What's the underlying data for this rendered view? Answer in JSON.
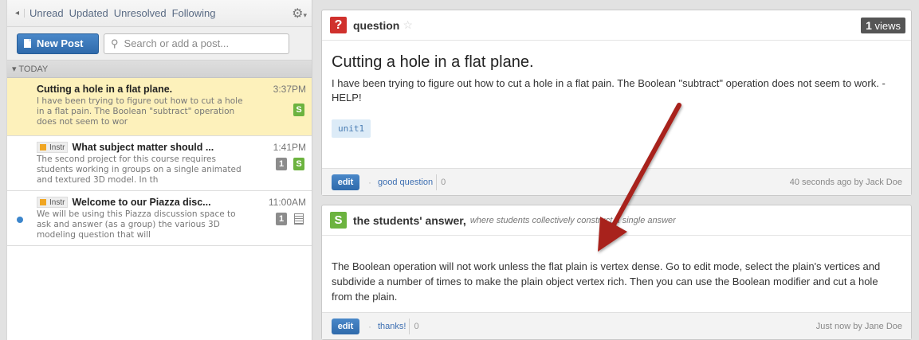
{
  "feed": {
    "collapse_glyph": "◂",
    "filters": [
      "Unread",
      "Updated",
      "Unresolved",
      "Following"
    ],
    "settings_icon": "gear-icon",
    "new_post_label": "New Post",
    "search_placeholder": "Search or add a post...",
    "group_label": "▾ TODAY",
    "posts": [
      {
        "title": "Cutting a hole in a flat plane.",
        "body": "I have been trying to figure out how to cut a hole in a flat pain. The Boolean \"subtract\" operation does not seem to wor",
        "time": "3:37PM",
        "badge_s": "S"
      },
      {
        "instr_label": "Instr",
        "title": "What subject matter should ...",
        "body": "The second project for this course requires students working in groups on a single animated and textured 3D model. In th",
        "time": "1:41PM",
        "badge_num": "1",
        "badge_s": "S"
      },
      {
        "instr_label": "Instr",
        "title": "Welcome to our Piazza disc...",
        "body": "We will be using this Piazza discussion space to ask and answer (as a group) the various 3D modeling question that will",
        "time": "11:00AM",
        "badge_num": "1"
      }
    ]
  },
  "question": {
    "icon_glyph": "?",
    "type_label": "question",
    "star_glyph": "☆",
    "views_count": "1",
    "views_label": "views",
    "title": "Cutting a hole in a flat plane.",
    "body": "I have been trying to figure out how to cut a hole in a flat pain. The Boolean \"subtract\" operation does not seem to work. - HELP!",
    "tag": "unit1",
    "edit_label": "edit",
    "good_question_label": "good question",
    "good_question_count": "0",
    "meta": "40 seconds ago by Jack Doe"
  },
  "answer": {
    "icon_glyph": "S",
    "heading": "the students' answer,",
    "subheading": "where students collectively construct a single answer",
    "body": "The Boolean operation will not work unless the flat plain is vertex dense.  Go to edit mode, select the plain's vertices and subdivide a number of times to make the plain object vertex rich. Then you can use the Boolean modifier and cut a hole from the plain.",
    "edit_label": "edit",
    "thanks_label": "thanks!",
    "thanks_count": "0",
    "meta": "Just now by Jane Doe"
  },
  "colors": {
    "accent_blue": "#2f6aab",
    "question_red": "#d0312d",
    "student_green": "#6cb33f",
    "selected_yellow": "#fdf1bb",
    "annotation_arrow": "#a8201a"
  }
}
